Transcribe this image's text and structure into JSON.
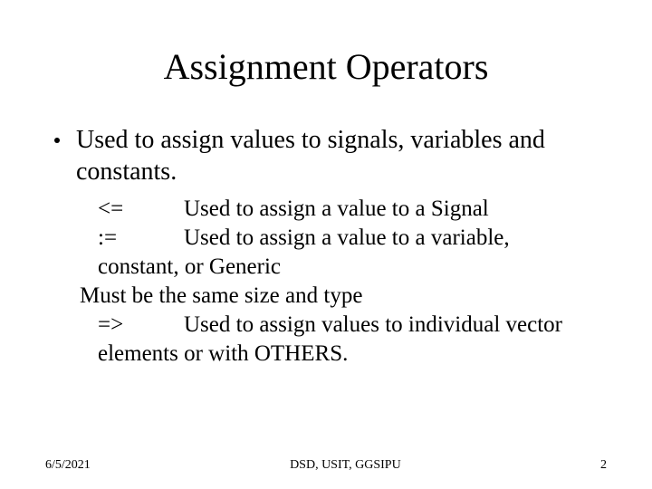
{
  "title": "Assignment Operators",
  "bullet": "Used to assign values to signals, variables and constants.",
  "ops": {
    "a": {
      "sym": "<=",
      "desc": "Used to assign a value to a Signal"
    },
    "b": {
      "sym": ":=",
      "desc": "Used to assign a value to a variable, constant, or Generic"
    },
    "note": "Must be the same size and type",
    "c": {
      "sym": "=>",
      "desc": "Used to assign values to individual vector elements or with OTHERS."
    }
  },
  "footer": {
    "date": "6/5/2021",
    "center": "DSD, USIT, GGSIPU",
    "page": "2"
  }
}
